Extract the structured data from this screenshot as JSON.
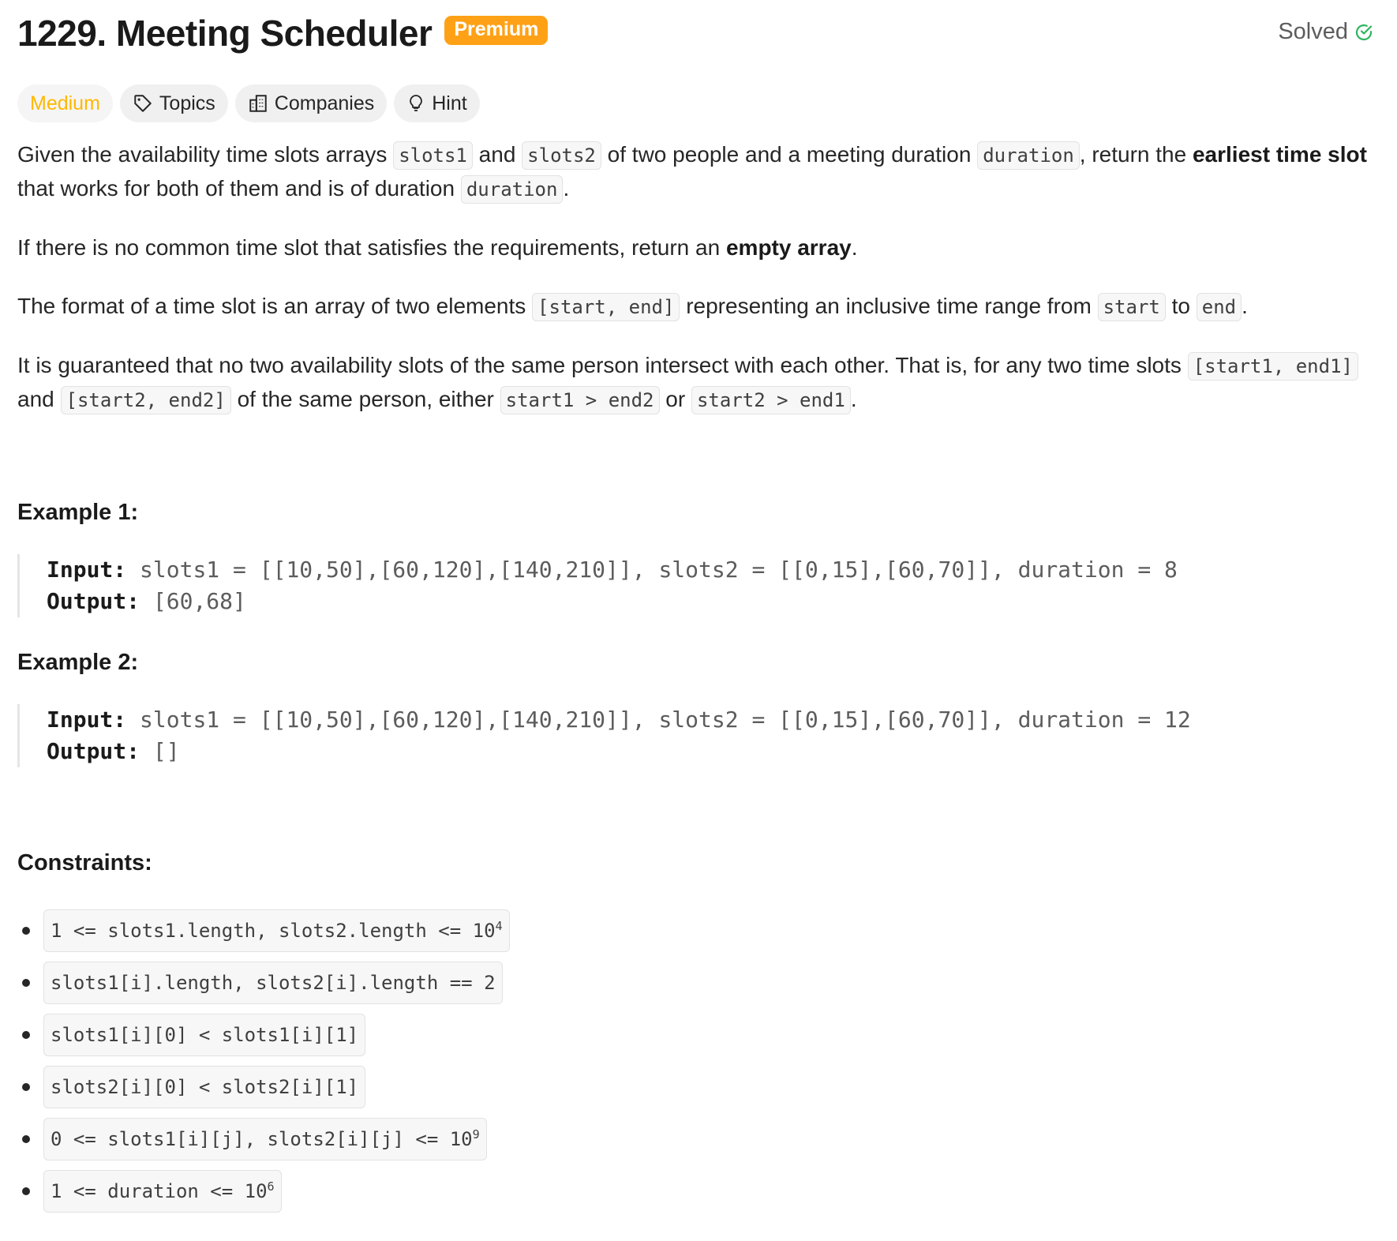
{
  "header": {
    "title": "1229. Meeting Scheduler",
    "premium_label": "Premium",
    "solved_label": "Solved"
  },
  "tags": {
    "difficulty": "Medium",
    "topics": "Topics",
    "companies": "Companies",
    "hint": "Hint"
  },
  "description": {
    "p1_a": "Given the availability time slots arrays ",
    "p1_code1": "slots1",
    "p1_b": " and ",
    "p1_code2": "slots2",
    "p1_c": " of two people and a meeting duration ",
    "p1_code3": "duration",
    "p1_d": ", return the ",
    "p1_bold": "earliest time slot",
    "p1_e": " that works for both of them and is of duration ",
    "p1_code4": "duration",
    "p1_f": ".",
    "p2_a": "If there is no common time slot that satisfies the requirements, return an ",
    "p2_bold": "empty array",
    "p2_b": ".",
    "p3_a": "The format of a time slot is an array of two elements ",
    "p3_code1": "[start, end]",
    "p3_b": " representing an inclusive time range from ",
    "p3_code2": "start",
    "p3_c": " to ",
    "p3_code3": "end",
    "p3_d": ".",
    "p4_a": "It is guaranteed that no two availability slots of the same person intersect with each other. That is, for any two time slots ",
    "p4_code1": "[start1, end1]",
    "p4_b": " and ",
    "p4_code2": "[start2, end2]",
    "p4_c": " of the same person, either ",
    "p4_code3": "start1 > end2",
    "p4_d": " or ",
    "p4_code4": "start2 > end1",
    "p4_e": "."
  },
  "examples": [
    {
      "title": "Example 1:",
      "input_label": "Input:",
      "input": " slots1 = [[10,50],[60,120],[140,210]], slots2 = [[0,15],[60,70]], duration = 8",
      "output_label": "Output:",
      "output": " [60,68]"
    },
    {
      "title": "Example 2:",
      "input_label": "Input:",
      "input": " slots1 = [[10,50],[60,120],[140,210]], slots2 = [[0,15],[60,70]], duration = 12",
      "output_label": "Output:",
      "output": " []"
    }
  ],
  "constraints": {
    "title": "Constraints:",
    "items": [
      {
        "text": "1 <= slots1.length, slots2.length <= 10",
        "sup": "4"
      },
      {
        "text": "slots1[i].length, slots2[i].length == 2",
        "sup": ""
      },
      {
        "text": "slots1[i][0] < slots1[i][1]",
        "sup": ""
      },
      {
        "text": "slots2[i][0] < slots2[i][1]",
        "sup": ""
      },
      {
        "text": "0 <= slots1[i][j], slots2[i][j] <= 10",
        "sup": "9"
      },
      {
        "text": "1 <= duration <= 10",
        "sup": "6"
      }
    ]
  },
  "colors": {
    "premium_bg": "#ffa116",
    "medium_text": "#ffb800",
    "solved_check": "#2db55d"
  },
  "icons": [
    "check-circle-icon",
    "tag-icon",
    "building-icon",
    "lightbulb-icon"
  ]
}
